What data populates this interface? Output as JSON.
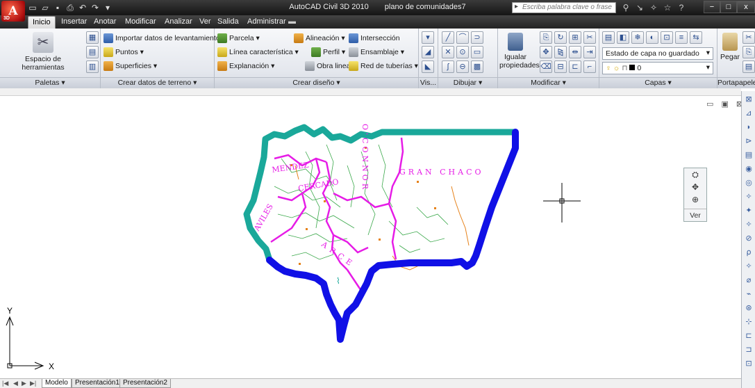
{
  "titlebar": {
    "logo_letter": "A",
    "logo_sub": "3D",
    "app_name": "AutoCAD Civil 3D 2010",
    "document": "plano de comunidades7",
    "search_placeholder": "Escriba palabra clave o frase",
    "min_label": "−",
    "max_label": "□",
    "close_label": "x"
  },
  "tabs": [
    "Inicio",
    "Insertar",
    "Anotar",
    "Modificar",
    "Analizar",
    "Ver",
    "Salida",
    "Administrar"
  ],
  "ribbon": {
    "paletas": {
      "title": "Paletas ▾",
      "button": "Espacio de herramientas"
    },
    "terreno": {
      "title": "Crear datos de terreno ▾",
      "items": [
        "Importar datos de levantamiento",
        "Puntos ▾",
        "Superficies ▾"
      ]
    },
    "diseno": {
      "title": "Crear diseño ▾",
      "col1": [
        "Parcela ▾",
        "Línea característica ▾",
        "Explanación ▾"
      ],
      "col2": [
        "Perfil ▾",
        "Obra lineal ▾"
      ],
      "col3": [
        "Alineación ▾",
        "Intersección",
        "Ensamblaje ▾",
        "Red de tuberías ▾"
      ]
    },
    "vis": {
      "title": "Vis..."
    },
    "dibujar": {
      "title": "Dibujar ▾"
    },
    "modificar": {
      "title": "Modificar ▾",
      "button_line1": "Igualar",
      "button_line2": "propiedades"
    },
    "capas": {
      "title": "Capas ▾",
      "state_select": "Estado de capa no guardado",
      "layer_select": "0"
    },
    "portapapeles": {
      "title": "Portapapeles",
      "button": "Pegar"
    }
  },
  "drawing": {
    "window_controls": "▭ ▣ ⊠",
    "labels": [
      "MENDEZ",
      "CERCADO",
      "AVILES",
      "ARCE",
      "O'CONNOR",
      "GRAN CHACO"
    ],
    "axis_y": "Y",
    "axis_x": "X",
    "viewtools_label": "Ver",
    "colors": {
      "outline_cyan": "#1aa89a",
      "outline_blue": "#1010e6",
      "magenta": "#e61ce6",
      "green": "#3aa84a",
      "orange": "#e6821a"
    }
  },
  "layout_tabs": [
    "Modelo",
    "Presentación1",
    "Presentación2"
  ]
}
